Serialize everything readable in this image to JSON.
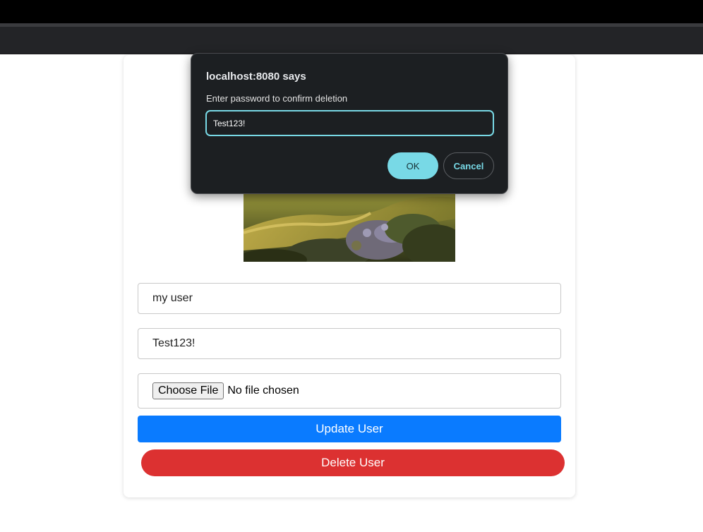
{
  "form": {
    "username_value": "my user",
    "password_value": "Test123!",
    "file_button_label": "Choose File",
    "file_status": "No file chosen",
    "update_label": "Update User",
    "delete_label": "Delete User"
  },
  "dialog": {
    "title": "localhost:8080 says",
    "message": "Enter password to confirm deletion",
    "input_value": "Test123!",
    "ok_label": "OK",
    "cancel_label": "Cancel"
  },
  "colors": {
    "update_button": "#0a7bff",
    "delete_button": "#dc3131",
    "dialog_accent": "#78d9e6",
    "dialog_background": "#1c1f22"
  }
}
